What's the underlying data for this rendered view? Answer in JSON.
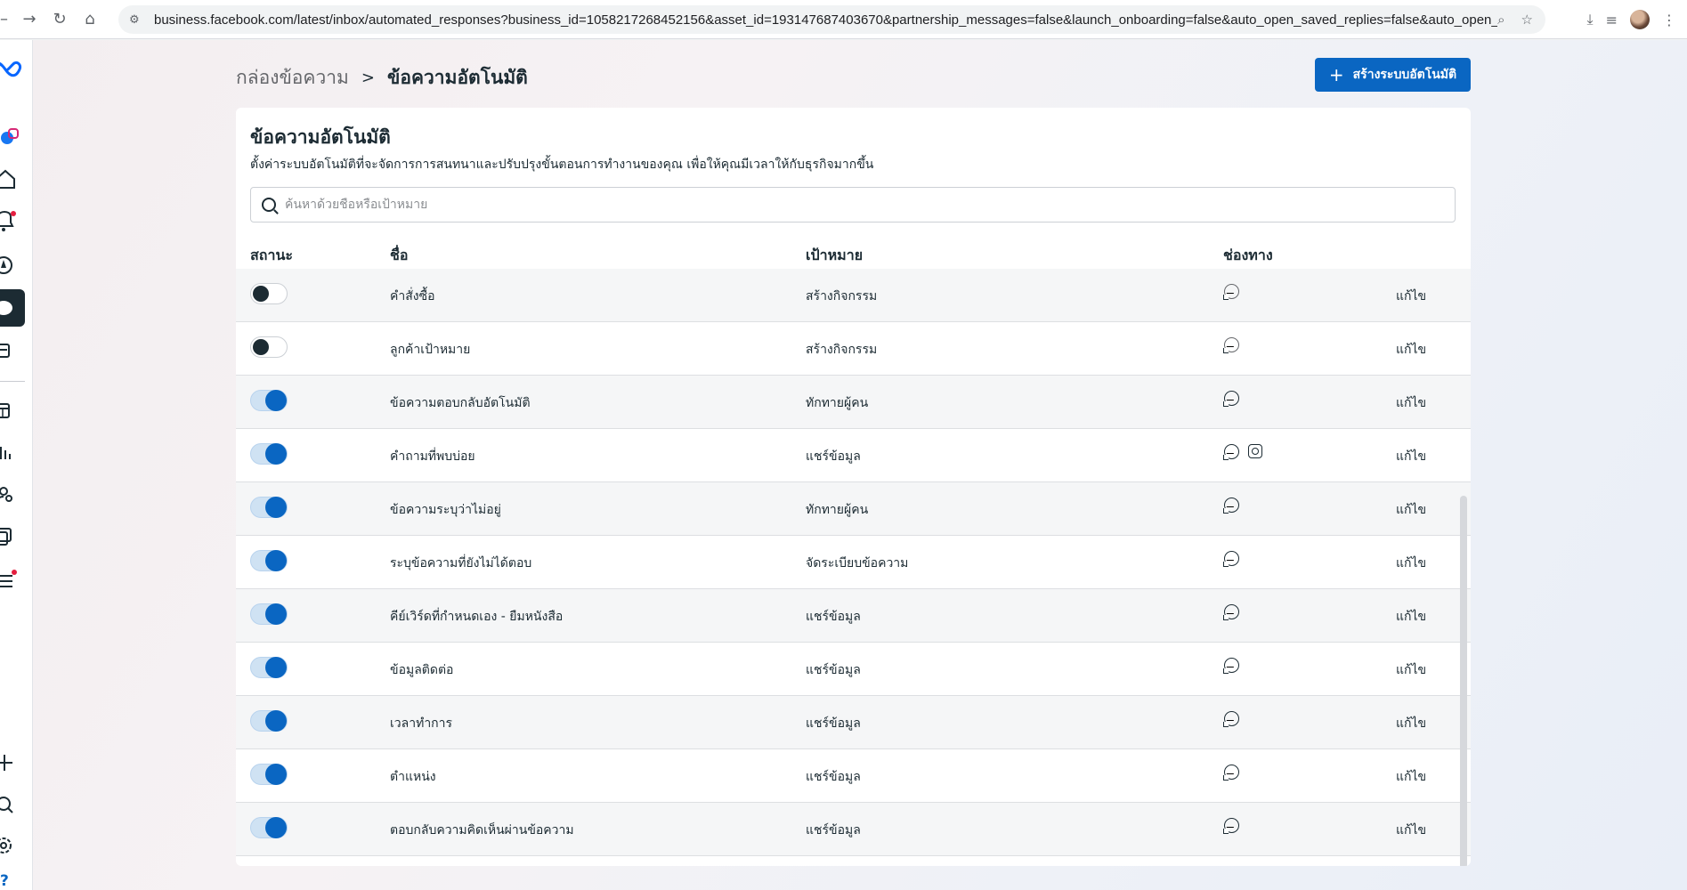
{
  "browser": {
    "url": "business.facebook.com/latest/inbox/automated_responses?business_id=1058217268452156&asset_id=193147687403670&partnership_messages=false&launch_onboarding=false&auto_open_saved_replies=false&auto_open_order_tip=false"
  },
  "header": {
    "breadcrumb_parent": "กล่องข้อความ",
    "breadcrumb_separator": ">",
    "breadcrumb_current": "ข้อความอัตโนมัติ",
    "create_button_label": "สร้างระบบอัตโนมัติ"
  },
  "card": {
    "title": "ข้อความอัตโนมัติ",
    "description": "ตั้งค่าระบบอัตโนมัติที่จะจัดการการสนทนาและปรับปรุงขั้นตอนการทำงานของคุณ เพื่อให้คุณมีเวลาให้กับธุรกิจมากขึ้น",
    "search_placeholder": "ค้นหาด้วยชื่อหรือเป้าหมาย"
  },
  "table": {
    "headers": {
      "status": "สถานะ",
      "name": "ชื่อ",
      "goal": "เป้าหมาย",
      "channel": "ช่องทาง"
    },
    "edit_label": "แก้ไข",
    "rows": [
      {
        "enabled": false,
        "name": "คำสั่งซื้อ",
        "goal": "สร้างกิจกรรม",
        "channels": [
          "messenger-icon"
        ]
      },
      {
        "enabled": false,
        "name": "ลูกค้าเป้าหมาย",
        "goal": "สร้างกิจกรรม",
        "channels": [
          "messenger-icon"
        ]
      },
      {
        "enabled": true,
        "name": "ข้อความตอบกลับอัตโนมัติ",
        "goal": "ทักทายผู้คน",
        "channels": [
          "messenger-icon"
        ]
      },
      {
        "enabled": true,
        "name": "คำถามที่พบบ่อย",
        "goal": "แชร์ข้อมูล",
        "channels": [
          "messenger-icon",
          "instagram-icon"
        ]
      },
      {
        "enabled": true,
        "name": "ข้อความระบุว่าไม่อยู่",
        "goal": "ทักทายผู้คน",
        "channels": [
          "messenger-icon"
        ]
      },
      {
        "enabled": true,
        "name": "ระบุข้อความที่ยังไม่ได้ตอบ",
        "goal": "จัดระเบียบข้อความ",
        "channels": [
          "messenger-icon"
        ]
      },
      {
        "enabled": true,
        "name": "คีย์เวิร์ดที่กำหนดเอง - ยืมหนังสือ",
        "goal": "แชร์ข้อมูล",
        "channels": [
          "messenger-icon"
        ]
      },
      {
        "enabled": true,
        "name": "ข้อมูลติดต่อ",
        "goal": "แชร์ข้อมูล",
        "channels": [
          "messenger-icon"
        ]
      },
      {
        "enabled": true,
        "name": "เวลาทำการ",
        "goal": "แชร์ข้อมูล",
        "channels": [
          "messenger-icon"
        ]
      },
      {
        "enabled": true,
        "name": "ตำแหน่ง",
        "goal": "แชร์ข้อมูล",
        "channels": [
          "messenger-icon"
        ]
      },
      {
        "enabled": true,
        "name": "ตอบกลับความคิดเห็นผ่านข้อความ",
        "goal": "แชร์ข้อมูล",
        "channels": [
          "messenger-icon"
        ]
      }
    ]
  },
  "colors": {
    "accent": "#0a66c2",
    "text": "#1c2b33",
    "notification": "#e41e3f"
  },
  "rail_icons": [
    "meta-logo-icon",
    "facebook-instagram-icon",
    "home-icon",
    "bell-icon",
    "compass-icon",
    "inbox-icon",
    "pages-icon",
    "calendar-icon",
    "insights-icon",
    "audience-icon",
    "content-icon",
    "menu-icon",
    "add-icon",
    "search-icon",
    "settings-icon",
    "help-icon"
  ],
  "help_glyph": "?"
}
